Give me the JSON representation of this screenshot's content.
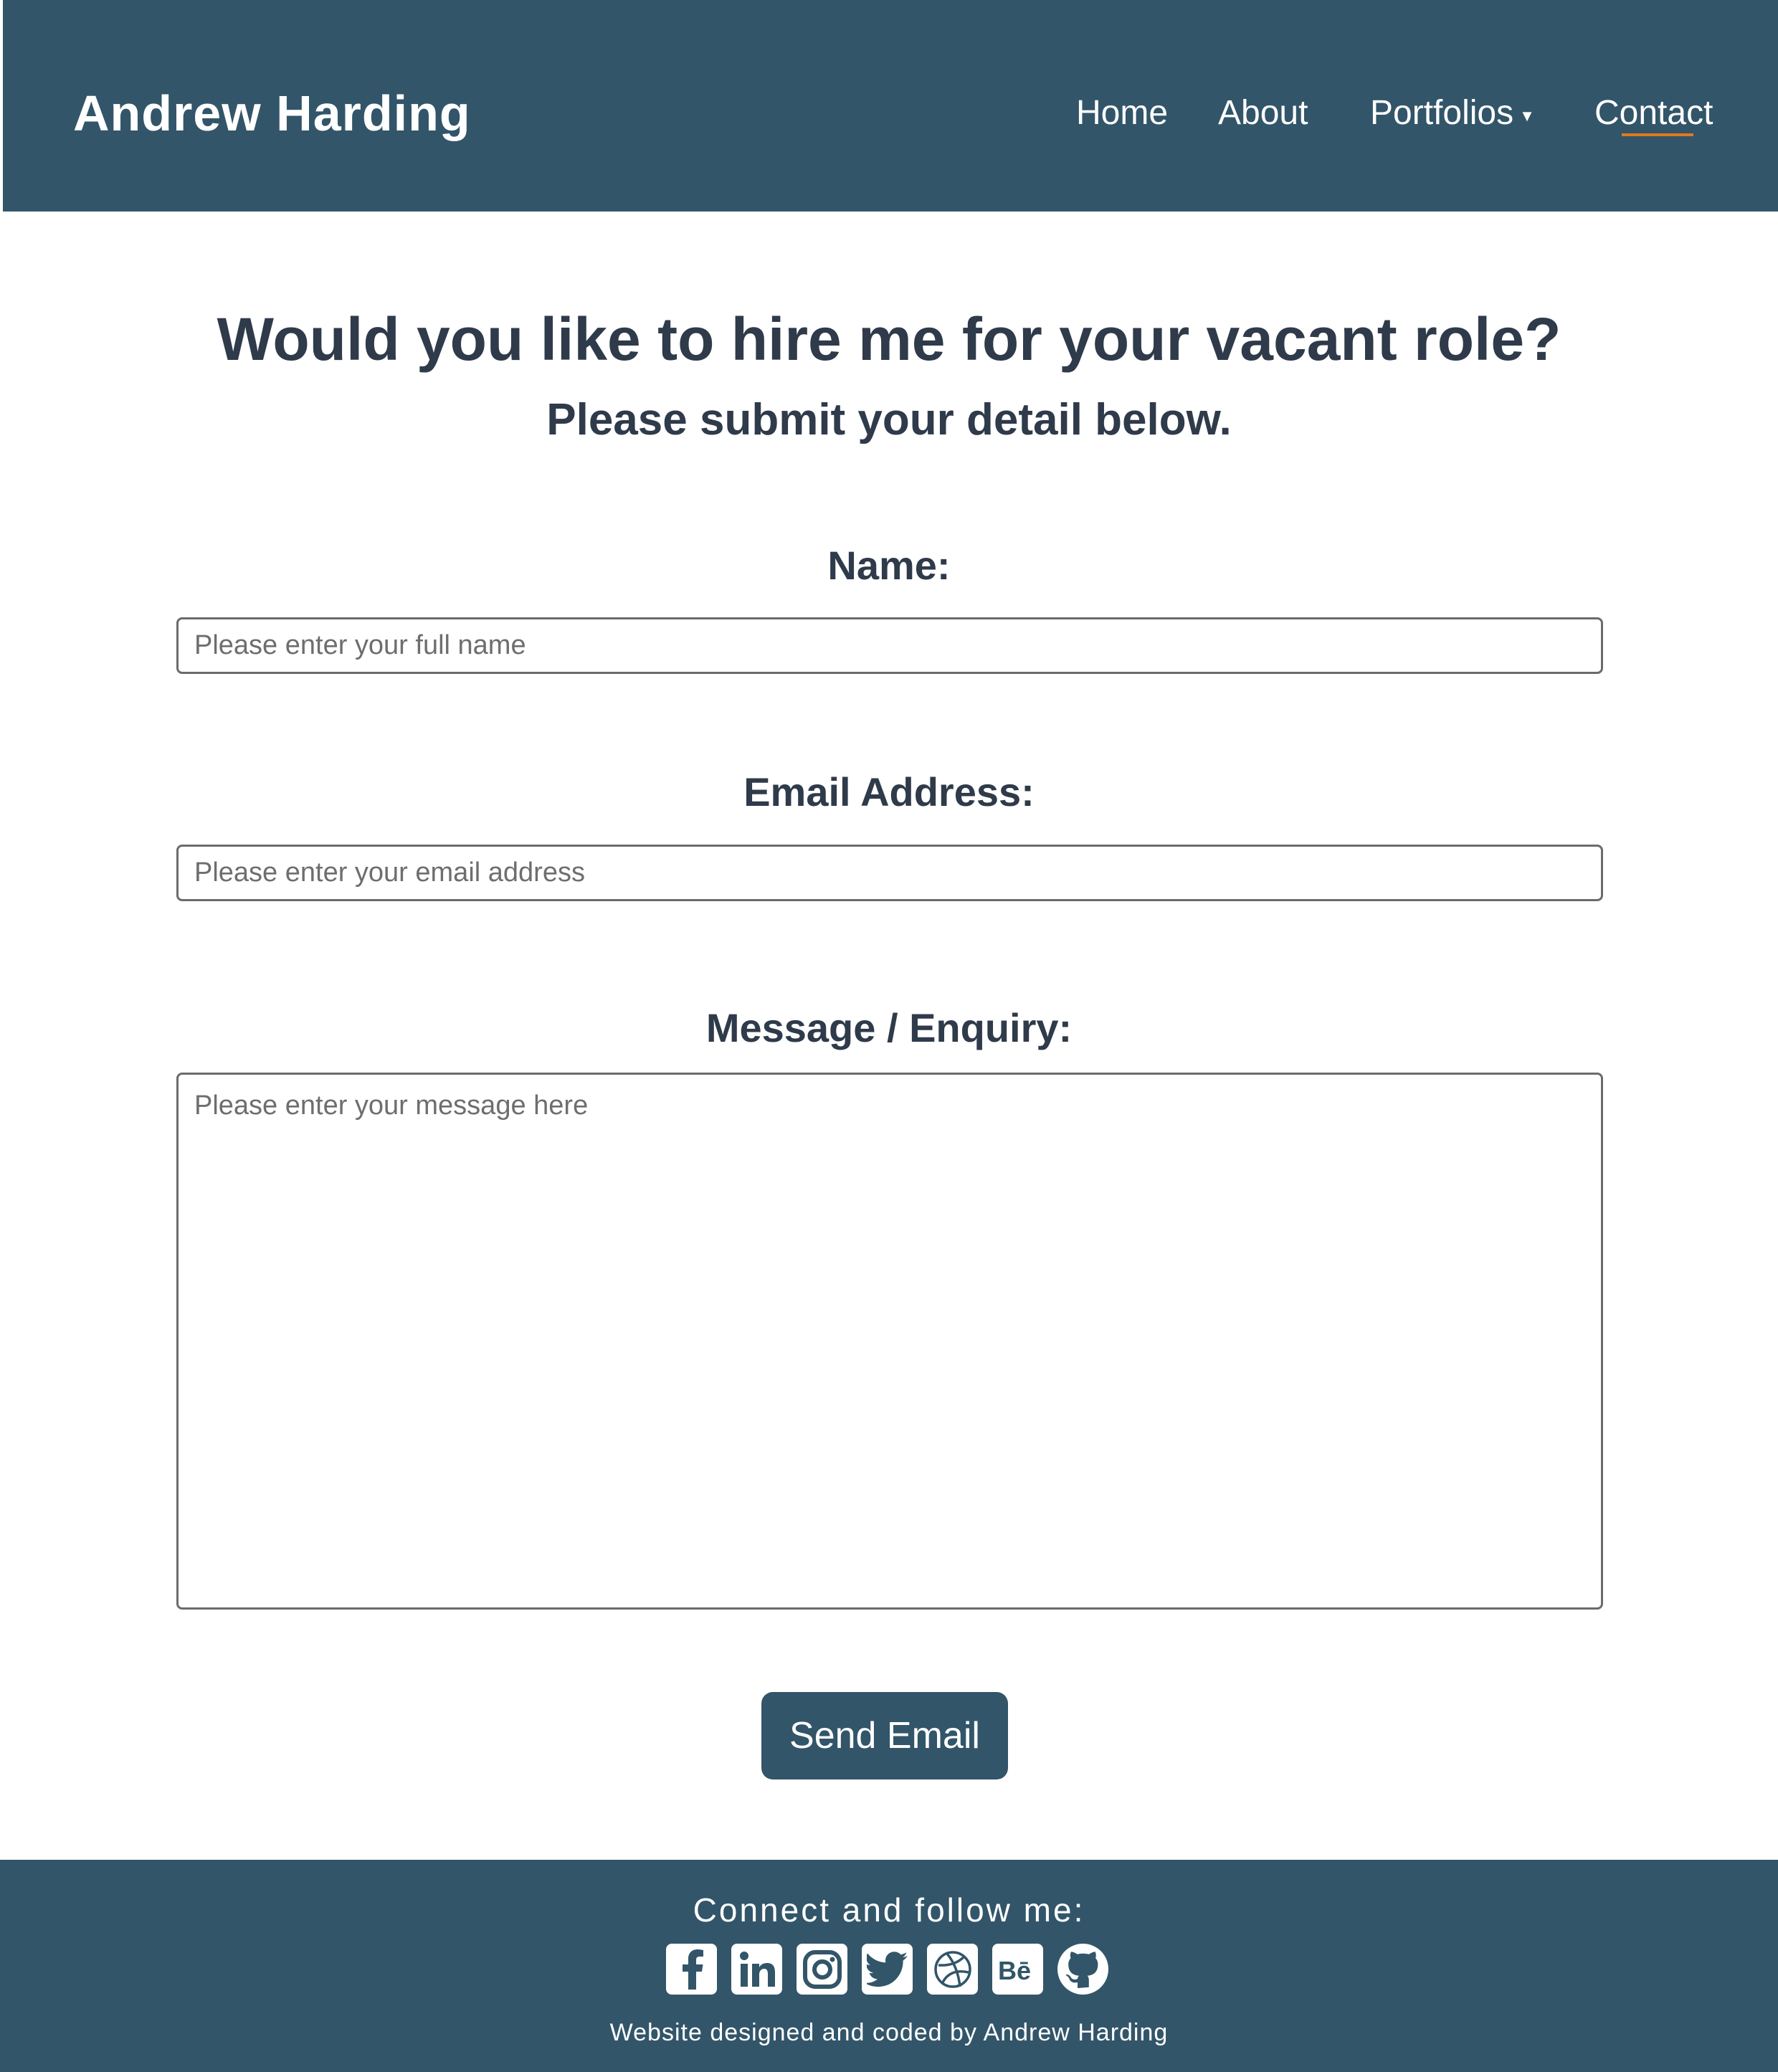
{
  "header": {
    "brand": "Andrew Harding",
    "nav": {
      "home": "Home",
      "about": "About",
      "portfolios": "Portfolios",
      "contact": "Contact"
    },
    "active": "contact"
  },
  "main": {
    "title": "Would you like to hire me for your vacant role?",
    "subtitle": "Please submit your detail below.",
    "form": {
      "name_label": "Name:",
      "name_placeholder": "Please enter your full name",
      "email_label": "Email Address:",
      "email_placeholder": "Please enter your email address",
      "message_label": "Message / Enquiry:",
      "message_placeholder": "Please enter your message here",
      "submit_label": "Send Email"
    }
  },
  "footer": {
    "title": "Connect and follow me:",
    "socials": [
      "facebook-icon",
      "linkedin-icon",
      "instagram-icon",
      "twitter-icon",
      "dribbble-icon",
      "behance-icon",
      "github-icon"
    ],
    "credit": "Website designed and coded by Andrew Harding"
  },
  "colors": {
    "header_bg": "#325569",
    "accent_underline": "#e07a1f",
    "text_dark": "#2f3a4a"
  }
}
